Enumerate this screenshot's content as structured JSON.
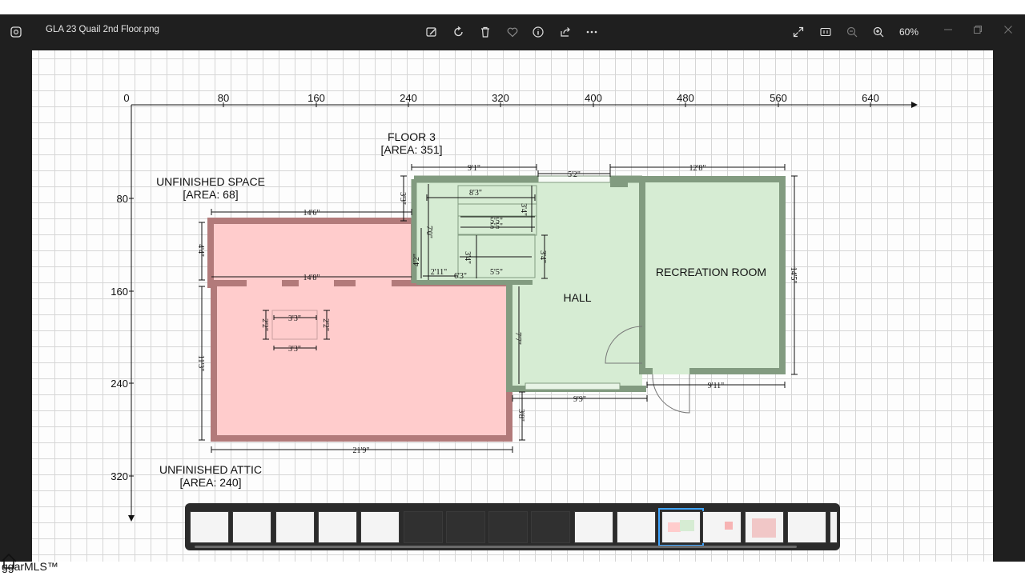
{
  "window": {
    "title": "GLA 23 Quail 2nd Floor.png",
    "zoom": "60%"
  },
  "toolbar": {
    "icons": [
      "edit-image-icon",
      "rotate-icon",
      "delete-icon",
      "favorite-icon",
      "info-icon",
      "share-icon",
      "more-icon"
    ],
    "right_icons": [
      "fullscreen-icon",
      "actual-size-icon",
      "zoom-out-icon",
      "zoom-in-icon"
    ]
  },
  "axis": {
    "x_ticks": [
      "0",
      "80",
      "160",
      "240",
      "320",
      "400",
      "480",
      "560",
      "640"
    ],
    "y_ticks": [
      "80",
      "160",
      "240",
      "320"
    ]
  },
  "plan": {
    "floor_title": "FLOOR 3",
    "floor_area": "[AREA: 351]",
    "unfinished_space": "UNFINISHED SPACE",
    "unfinished_space_area": "[AREA: 68]",
    "attic": "UNFINISHED ATTIC",
    "attic_area": "[AREA: 240]",
    "hall": "HALL",
    "recreation": "RECREATION ROOM",
    "dims": {
      "d_9_1": "9'1\"",
      "d_5_2": "5'2\"",
      "d_12_8": "12'8\"",
      "d_3_3v": "3'3\"",
      "d_8_3": "8'3\"",
      "d_3_4a": "3'4\"",
      "d_5_5a": "5'5\"",
      "d_5_5b": "5'5\"",
      "d_7_0": "7'0\"",
      "d_3_4b": "3'4\"",
      "d_3_4c": "3'4\"",
      "d_4_2": "4'2\"",
      "d_2_11": "2'11\"",
      "d_6_3": "6'3\"",
      "d_5_5c": "5'5\"",
      "d_14_6": "14'6\"",
      "d_4_4": "4'4\"",
      "d_14_8": "14'8\"",
      "d_3_3a": "3'3\"",
      "d_3_3b": "3'3\"",
      "d_2_2a": "2'2\"",
      "d_2_2b": "2'2\"",
      "d_11_3": "11'3\"",
      "d_7_7": "7'7\"",
      "d_14_5": "14'5\"",
      "d_9_9": "9'9\"",
      "d_9_11": "9'11\"",
      "d_3_8": "3'8\"",
      "d_21_9": "21'9\""
    }
  },
  "footer": {
    "brand": "ggarMLS™"
  },
  "colors": {
    "finished_fill": "#d6ecd3",
    "finished_wall": "#829b80",
    "unfinished_fill": "#ffcccc",
    "unfinished_wall": "#b27a7a",
    "selection": "#3fa4ff"
  }
}
